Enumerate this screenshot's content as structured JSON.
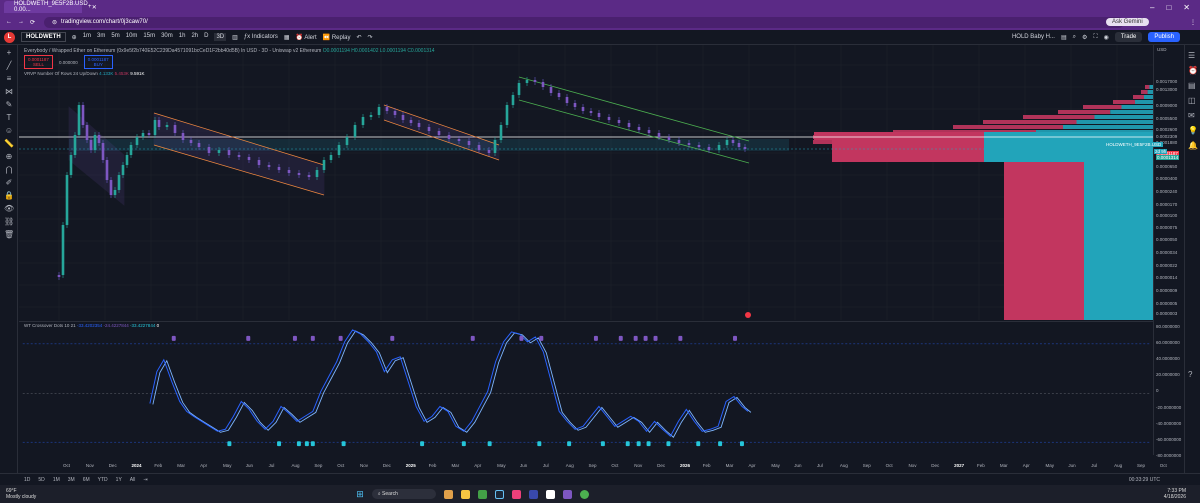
{
  "browser": {
    "tab_title": "HOLDWETH_9E5F2B.USD 0.00...",
    "url": "tradingview.com/chart/0j3caw70/",
    "ask_gemini": "Ask Gemini"
  },
  "toolbar": {
    "symbol": "HOLDWETH",
    "timeframes": [
      "1m",
      "3m",
      "5m",
      "10m",
      "15m",
      "30m",
      "1h",
      "2h",
      "D",
      "3D"
    ],
    "active_timeframe": "3D",
    "indicators": "Indicators",
    "alert": "Alert",
    "replay": "Replay",
    "watchlist_symbol": "HOLD Baby H...",
    "trade": "Trade",
    "publish": "Publish"
  },
  "legend": {
    "title": "Everybody / Wrapped Ether on Ethereum (0x9e5f2b740E52C239Da4571091bcCeD1F2bb40d5B) In USD - 3D - Uniswap v2 Ethereum",
    "values": "O0.0001194 H0.0001402 L0.0001194 C0.0001314",
    "sell_price": "0.0001187",
    "sell_label": "SELL",
    "spread": "0.000000",
    "buy_price": "0.0001187",
    "buy_label": "BUY",
    "vrvp": "VRVP Number Of Rows 24 Up/Down",
    "vrvp_values": [
      "4.133K",
      "5.453K",
      "9.591K"
    ]
  },
  "price_axis": {
    "currency": "USD",
    "ticks": [
      "0.0017000",
      "0.0013000",
      "0.0009000",
      "0.0005500",
      "0.0002600",
      "0.0002309",
      "0.0001880",
      "0.0001187",
      "0.0001314",
      "0.0000650",
      "0.0000400",
      "0.0000240",
      "0.0000170",
      "0.0000100",
      "0.0000075",
      "0.0000050",
      "0.0000034",
      "0.0000022",
      "0.0000014",
      "0.0000009",
      "0.0000005",
      "0.0000003"
    ],
    "symbol_tag": "HOLDWETH_9E5F2B.USD",
    "symbol_price": "0.0001314",
    "countdown": "2d 9h"
  },
  "oscillator": {
    "title": "WT Crossover Dots 10 21",
    "values": [
      "-33.4202354",
      "-24.4227844",
      "-33.4227844",
      "0"
    ],
    "ticks": [
      "80.0000000",
      "60.0000000",
      "40.0000000",
      "20.0000000",
      "0",
      "-20.0000000",
      "-40.0000000",
      "-60.0000000",
      "-80.0000000"
    ]
  },
  "time_axis": [
    "Oct",
    "Nov",
    "Dec",
    "2024",
    "Feb",
    "Mar",
    "Apr",
    "May",
    "Jun",
    "Jul",
    "Aug",
    "Sep",
    "Oct",
    "Nov",
    "Dec",
    "2025",
    "Feb",
    "Mar",
    "Apr",
    "May",
    "Jun",
    "Jul",
    "Aug",
    "Sep",
    "Oct",
    "Nov",
    "Dec",
    "2026",
    "Feb",
    "Mar",
    "Apr",
    "May",
    "Jun",
    "Jul",
    "Aug",
    "Sep",
    "Oct",
    "Nov",
    "Dec",
    "2027",
    "Feb",
    "Mar",
    "Apr",
    "May",
    "Jun",
    "Jul",
    "Aug",
    "Sep",
    "Oct"
  ],
  "bottom_bar": {
    "ranges": [
      "1D",
      "5D",
      "1M",
      "3M",
      "6M",
      "YTD",
      "1Y",
      "All"
    ],
    "clock": "00:33:29 UTC"
  },
  "taskbar": {
    "temp": "69°F",
    "weather": "Mostly cloudy",
    "search": "Search",
    "time": "7:33 PM",
    "date": "4/18/2026"
  },
  "colors": {
    "up": "#26a69a",
    "down": "#f23645",
    "line": "#2962ff",
    "channel_orange": "#f0883e",
    "channel_green": "#4caf50",
    "vp_up": "#22a4ba",
    "vp_down": "#c2365f",
    "dot_purple": "#7e57c2",
    "dot_teal": "#26c6da"
  }
}
